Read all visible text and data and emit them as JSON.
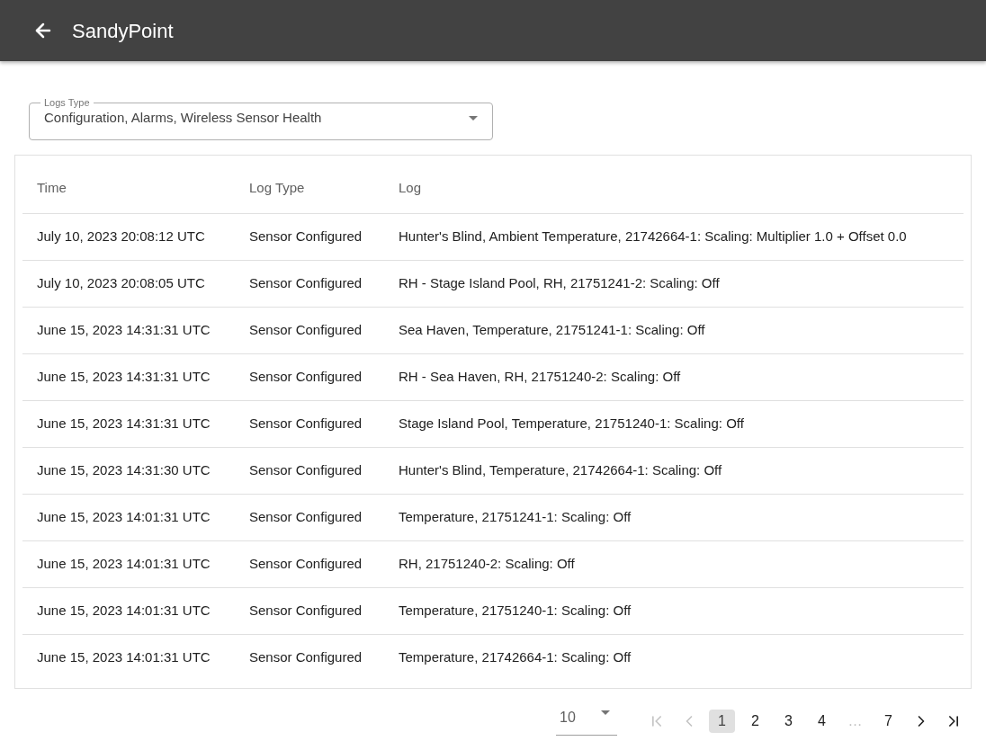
{
  "app_bar": {
    "title": "SandyPoint"
  },
  "logs_type": {
    "label": "Logs Type",
    "value": "Configuration, Alarms, Wireless Sensor Health"
  },
  "table": {
    "columns": [
      "Time",
      "Log Type",
      "Log"
    ],
    "rows": [
      [
        "July 10, 2023 20:08:12 UTC",
        "Sensor Configured",
        "Hunter's Blind, Ambient Temperature, 21742664-1: Scaling: Multiplier 1.0 + Offset 0.0"
      ],
      [
        "July 10, 2023 20:08:05 UTC",
        "Sensor Configured",
        "RH - Stage Island Pool, RH, 21751241-2: Scaling: Off"
      ],
      [
        "June 15, 2023 14:31:31 UTC",
        "Sensor Configured",
        "Sea Haven, Temperature, 21751241-1: Scaling: Off"
      ],
      [
        "June 15, 2023 14:31:31 UTC",
        "Sensor Configured",
        "RH - Sea Haven, RH, 21751240-2: Scaling: Off"
      ],
      [
        "June 15, 2023 14:31:31 UTC",
        "Sensor Configured",
        "Stage Island Pool, Temperature, 21751240-1: Scaling: Off"
      ],
      [
        "June 15, 2023 14:31:30 UTC",
        "Sensor Configured",
        "Hunter's Blind, Temperature, 21742664-1: Scaling: Off"
      ],
      [
        "June 15, 2023 14:01:31 UTC",
        "Sensor Configured",
        "Temperature, 21751241-1: Scaling: Off"
      ],
      [
        "June 15, 2023 14:01:31 UTC",
        "Sensor Configured",
        "RH, 21751240-2: Scaling: Off"
      ],
      [
        "June 15, 2023 14:01:31 UTC",
        "Sensor Configured",
        "Temperature, 21751240-1: Scaling: Off"
      ],
      [
        "June 15, 2023 14:01:31 UTC",
        "Sensor Configured",
        "Temperature, 21742664-1: Scaling: Off"
      ]
    ]
  },
  "pagination": {
    "rows_per_page": "10",
    "first": {
      "disabled": true
    },
    "previous": {
      "disabled": true
    },
    "pages": [
      {
        "kind": "page",
        "label": "1",
        "selected": true
      },
      {
        "kind": "page",
        "label": "2",
        "selected": false
      },
      {
        "kind": "page",
        "label": "3",
        "selected": false
      },
      {
        "kind": "page",
        "label": "4",
        "selected": false
      },
      {
        "kind": "ellipsis",
        "label": "…"
      },
      {
        "kind": "page",
        "label": "7",
        "selected": false
      }
    ],
    "next": {
      "disabled": false
    },
    "last": {
      "disabled": false
    }
  }
}
